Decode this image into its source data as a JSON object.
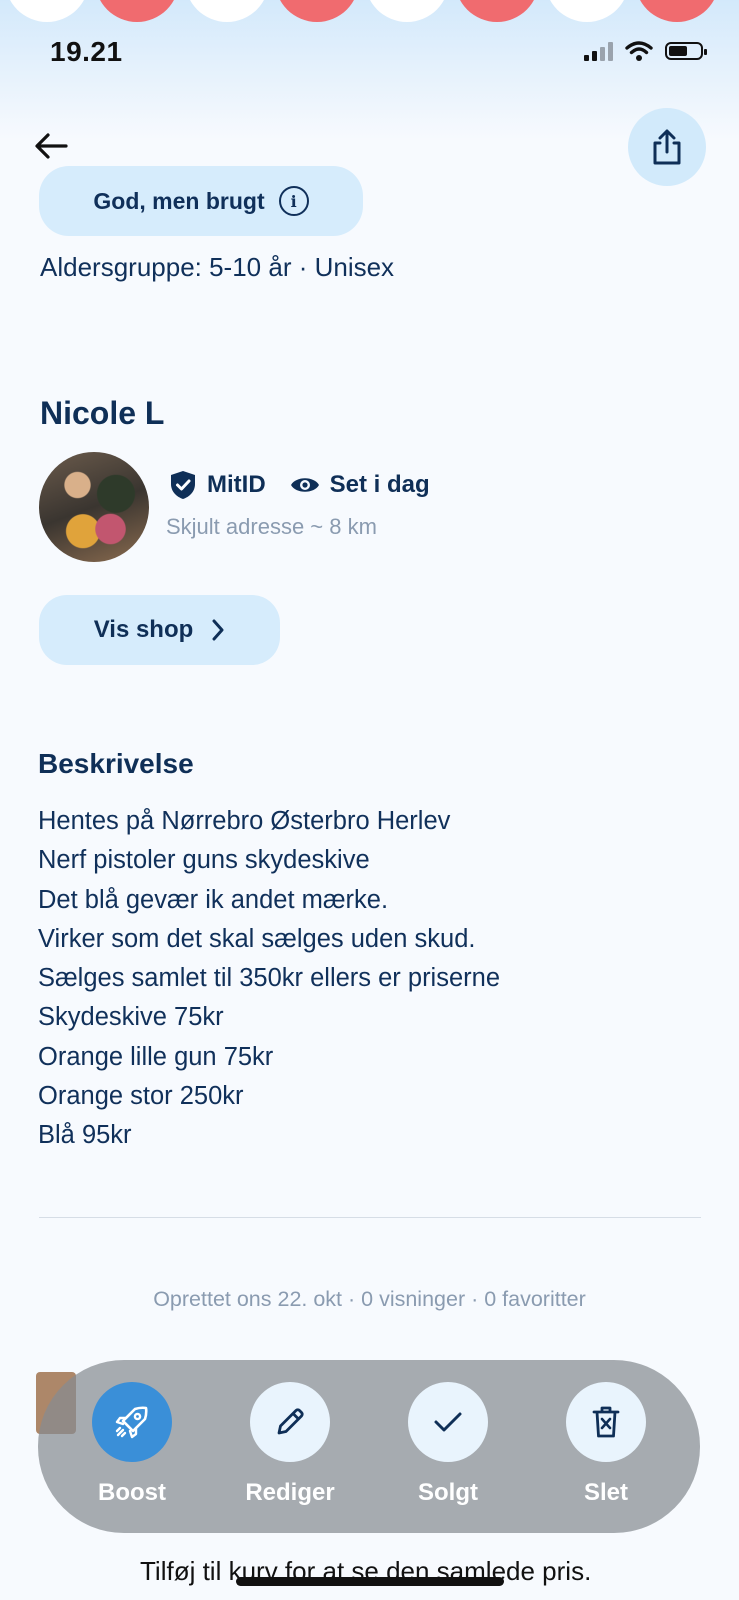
{
  "status_bar": {
    "time": "19.21"
  },
  "header": {
    "back_icon": "arrow-left-icon",
    "share_icon": "share-icon"
  },
  "listing": {
    "condition": "God, men brugt",
    "age_line": "Aldersgruppe: 5-10 år · Unisex"
  },
  "seller": {
    "name": "Nicole L",
    "badge_mitid": "MitID",
    "badge_seen": "Set i dag",
    "distance": "Skjult adresse ~ 8 km",
    "shop_button": "Vis shop"
  },
  "description": {
    "title": "Beskrivelse",
    "lines": [
      "Hentes på Nørrebro Østerbro Herlev",
      "Nerf pistoler guns skydeskive",
      "Det blå gevær ik andet mærke.",
      "Virker som det skal sælges uden skud.",
      "Sælges samlet til 350kr ellers er priserne",
      "Skydeskive 75kr",
      "Orange lille gun 75kr",
      "Orange stor 250kr",
      "Blå 95kr"
    ]
  },
  "meta": "Oprettet ons 22. okt · 0 visninger · 0 favoritter",
  "actions": {
    "boost": "Boost",
    "edit": "Rediger",
    "sold": "Solgt",
    "delete": "Slet"
  },
  "bottom_text": "Tilføj til kurv for at se den samlede pris.",
  "colors": {
    "primary_text": "#0f2f57",
    "chip_bg": "#d6ecfc",
    "boost_accent": "#3a8fd8",
    "muted": "#8a9bb0"
  }
}
